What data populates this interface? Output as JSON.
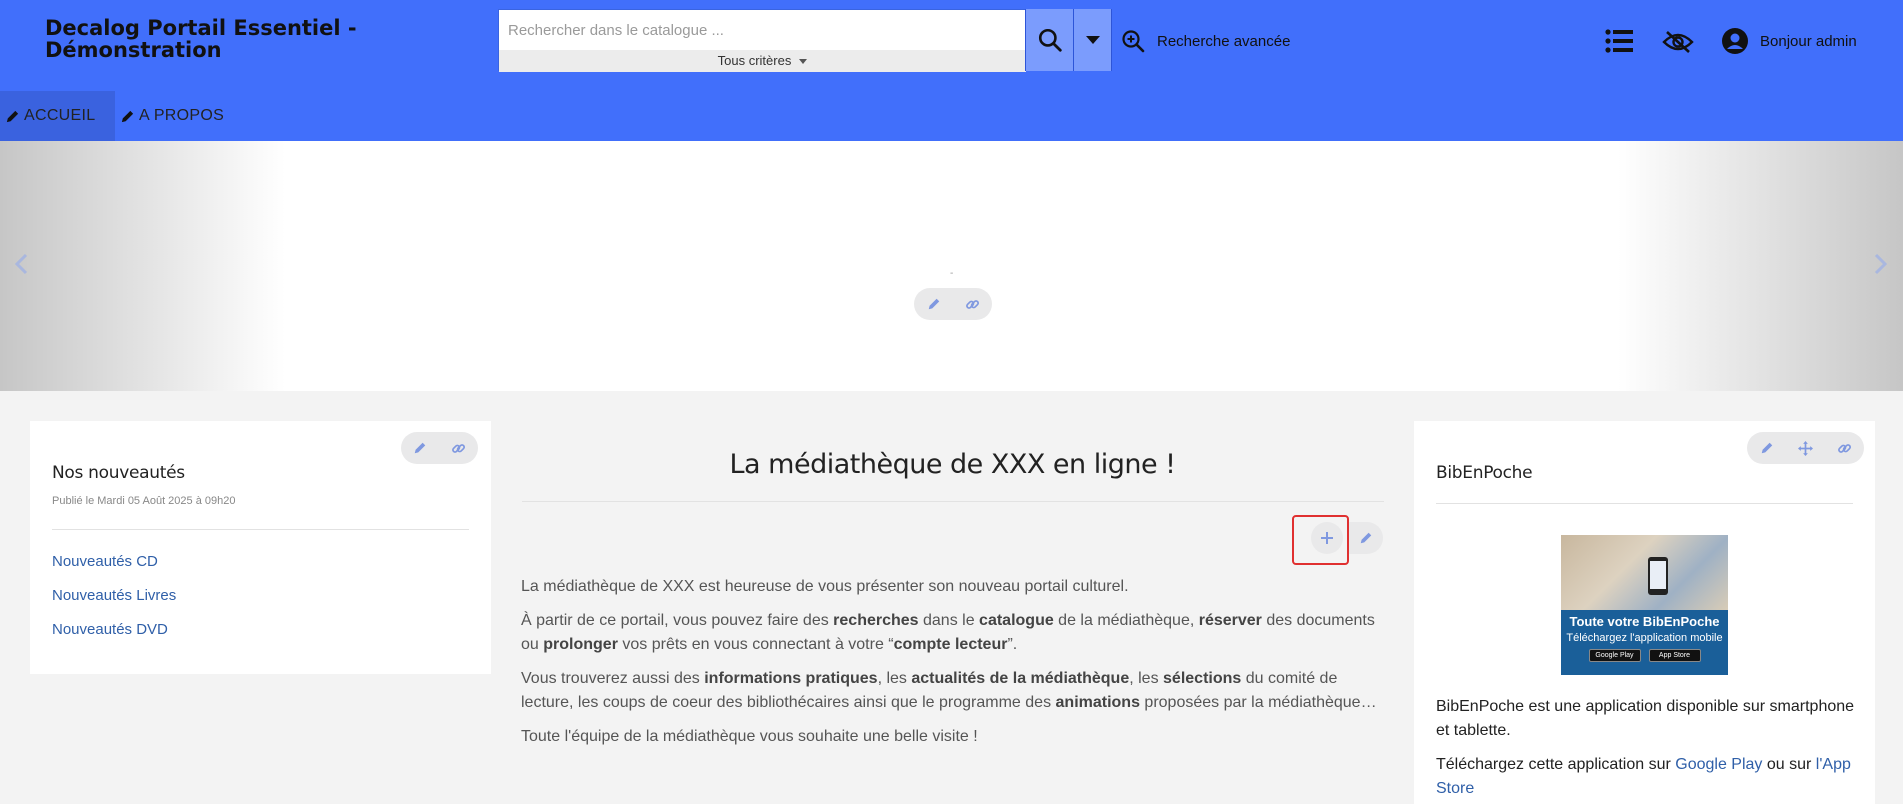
{
  "header": {
    "site_title": "Decalog Portail Essentiel - Démonstration",
    "search_placeholder": "Rechercher dans le catalogue ...",
    "search_criteria": "Tous critères",
    "advanced_search": "Recherche avancée",
    "greeting": "Bonjour admin",
    "color_bar": "#416ffb"
  },
  "nav": {
    "items": [
      {
        "label": "ACCUEIL"
      },
      {
        "label": "A PROPOS"
      }
    ]
  },
  "banner": {
    "caption": "-"
  },
  "left_panel": {
    "title": "Nos nouveautés",
    "published": "Publié le Mardi 05 Août 2025 à 09h20",
    "links": [
      "Nouveautés CD",
      "Nouveautés Livres",
      "Nouveautés DVD"
    ]
  },
  "center": {
    "title": "La médiathèque de XXX en ligne !",
    "p1": "La médiathèque de XXX est heureuse de vous présenter son nouveau portail culturel.",
    "p2": {
      "t1": "À partir de ce portail, vous pouvez faire des ",
      "b1": "recherches",
      "t2": " dans le ",
      "b2": "catalogue",
      "t3": " de la médiathèque, ",
      "b3": "réserver",
      "t4": " des documents ou ",
      "b4": "prolonger",
      "t5": " vos prêts en vous connectant à votre “",
      "b5": "compte lecteur",
      "t6": "”."
    },
    "p3": {
      "t1": "Vous trouverez aussi des ",
      "b1": "informations pratiques",
      "t2": ", les ",
      "b2": "actualités de la médiathèque",
      "t3": ", les ",
      "b3": "sélections",
      "t4": " du comité de lecture, les coups de coeur des bibliothécaires ainsi que le programme des ",
      "b4": "animations",
      "t5": " proposées par la médiathèque…"
    },
    "p4": "Toute l'équipe de la médiathèque vous souhaite une belle visite !"
  },
  "right_panel": {
    "title": "BibEnPoche",
    "image": {
      "line1": "Toute votre BibEnPoche",
      "line2": "Téléchargez l'application mobile",
      "badge1": "Google Play",
      "badge2": "App Store"
    },
    "desc": "BibEnPoche est une application disponible sur smartphone et tablette.",
    "download": {
      "t1": "Téléchargez cette application sur ",
      "l1": "Google Play",
      "t2": " ou sur ",
      "l2": "l'App Store"
    }
  }
}
